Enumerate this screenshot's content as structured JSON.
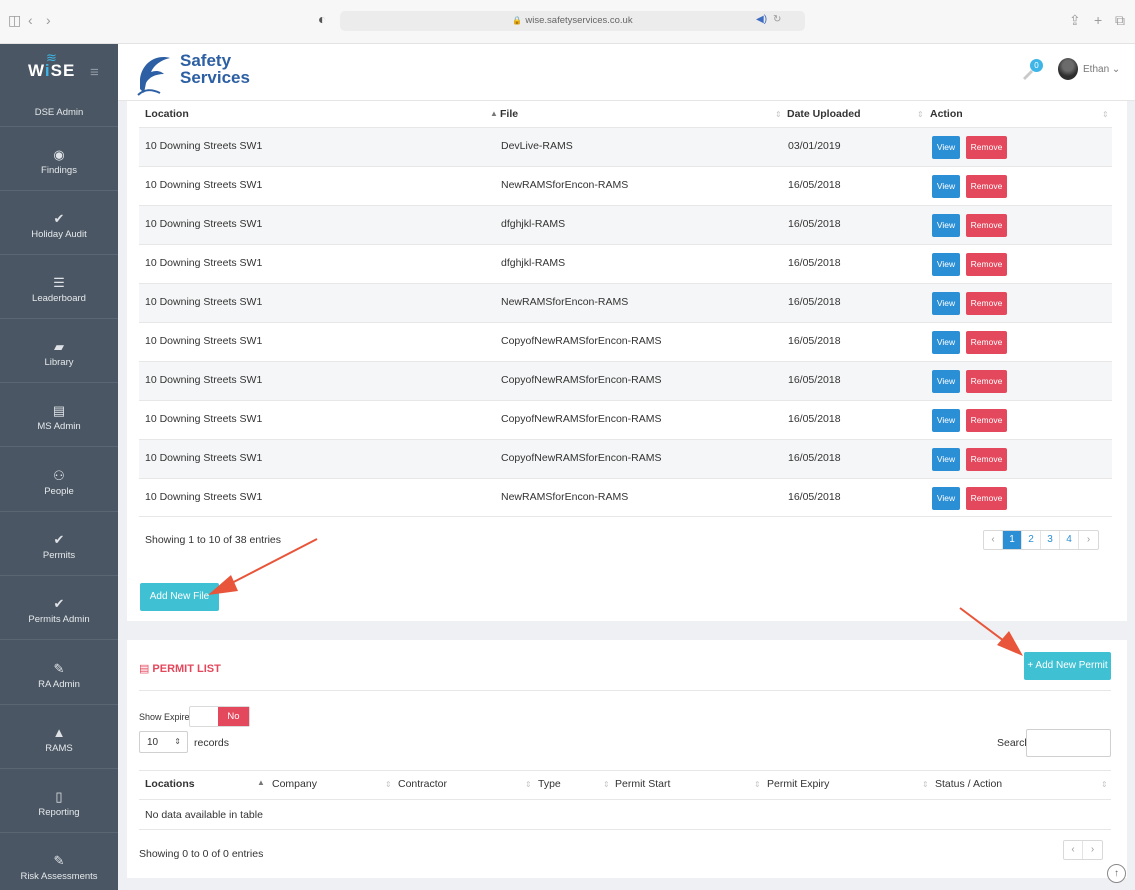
{
  "browser": {
    "url": "wise.safetyservices.co.uk",
    "icons": [
      "sidebar-toggle-icon",
      "back-icon",
      "forward-icon",
      "shield-icon",
      "share-icon",
      "new-tab-icon",
      "tabs-icon"
    ]
  },
  "header": {
    "app_logo_prefix": "W",
    "app_logo_accent": "i",
    "app_logo_suffix": "SE",
    "brand_line1": "Safety",
    "brand_line2": "Services",
    "notification_count": "0",
    "user_name": "Ethan ⌄"
  },
  "sidebar": {
    "items": [
      {
        "label": "DSE Admin",
        "icon": "desktop-icon"
      },
      {
        "label": "Findings",
        "icon": "eye-icon"
      },
      {
        "label": "Holiday Audit",
        "icon": "check-icon"
      },
      {
        "label": "Leaderboard",
        "icon": "list-icon"
      },
      {
        "label": "Library",
        "icon": "book-icon"
      },
      {
        "label": "MS Admin",
        "icon": "table-icon"
      },
      {
        "label": "People",
        "icon": "users-icon"
      },
      {
        "label": "Permits",
        "icon": "check-icon"
      },
      {
        "label": "Permits Admin",
        "icon": "check-icon"
      },
      {
        "label": "RA Admin",
        "icon": "pencil-icon"
      },
      {
        "label": "RAMS",
        "icon": "warning-icon"
      },
      {
        "label": "Reporting",
        "icon": "document-icon"
      },
      {
        "label": "Risk Assessments",
        "icon": "pencil-icon"
      }
    ]
  },
  "files_table": {
    "columns": [
      "Location",
      "File",
      "Date Uploaded",
      "Action"
    ],
    "rows": [
      {
        "location": "10 Downing Streets SW1",
        "file": "DevLive-RAMS",
        "date": "03/01/2019"
      },
      {
        "location": "10 Downing Streets SW1",
        "file": "NewRAMSforEncon-RAMS",
        "date": "16/05/2018"
      },
      {
        "location": "10 Downing Streets SW1",
        "file": "dfghjkl-RAMS",
        "date": "16/05/2018"
      },
      {
        "location": "10 Downing Streets SW1",
        "file": "dfghjkl-RAMS",
        "date": "16/05/2018"
      },
      {
        "location": "10 Downing Streets SW1",
        "file": "NewRAMSforEncon-RAMS",
        "date": "16/05/2018"
      },
      {
        "location": "10 Downing Streets SW1",
        "file": "CopyofNewRAMSforEncon-RAMS",
        "date": "16/05/2018"
      },
      {
        "location": "10 Downing Streets SW1",
        "file": "CopyofNewRAMSforEncon-RAMS",
        "date": "16/05/2018"
      },
      {
        "location": "10 Downing Streets SW1",
        "file": "CopyofNewRAMSforEncon-RAMS",
        "date": "16/05/2018"
      },
      {
        "location": "10 Downing Streets SW1",
        "file": "CopyofNewRAMSforEncon-RAMS",
        "date": "16/05/2018"
      },
      {
        "location": "10 Downing Streets SW1",
        "file": "NewRAMSforEncon-RAMS",
        "date": "16/05/2018"
      }
    ],
    "view_label": "View",
    "remove_label": "Remove",
    "info": "Showing 1 to 10 of 38 entries",
    "pagination": {
      "prev": "‹",
      "pages": [
        "1",
        "2",
        "3",
        "4"
      ],
      "next": "›",
      "current": "1"
    },
    "add_button": "Add New File"
  },
  "permit_list": {
    "title": "PERMIT LIST",
    "title_icon": "list-alt-icon",
    "add_button": "+ Add New Permit",
    "show_expired_label": "Show Expired?",
    "show_expired_value": "No",
    "records_value": "10",
    "records_label": "records",
    "search_label": "Search:",
    "search_placeholder": "",
    "columns": [
      "Locations",
      "Company",
      "Contractor",
      "Type",
      "Permit Start",
      "Permit Expiry",
      "Status / Action"
    ],
    "empty_message": "No data available in table",
    "info": "Showing 0 to 0 of 0 entries",
    "pagination": {
      "prev": "‹",
      "next": "›"
    }
  },
  "colors": {
    "sidebar": "#4a5663",
    "primary": "#2b8fd6",
    "danger": "#e4485c",
    "cyan": "#3fc1d3",
    "brand": "#2c5fa3",
    "annotation_arrow": "#e8553a"
  }
}
